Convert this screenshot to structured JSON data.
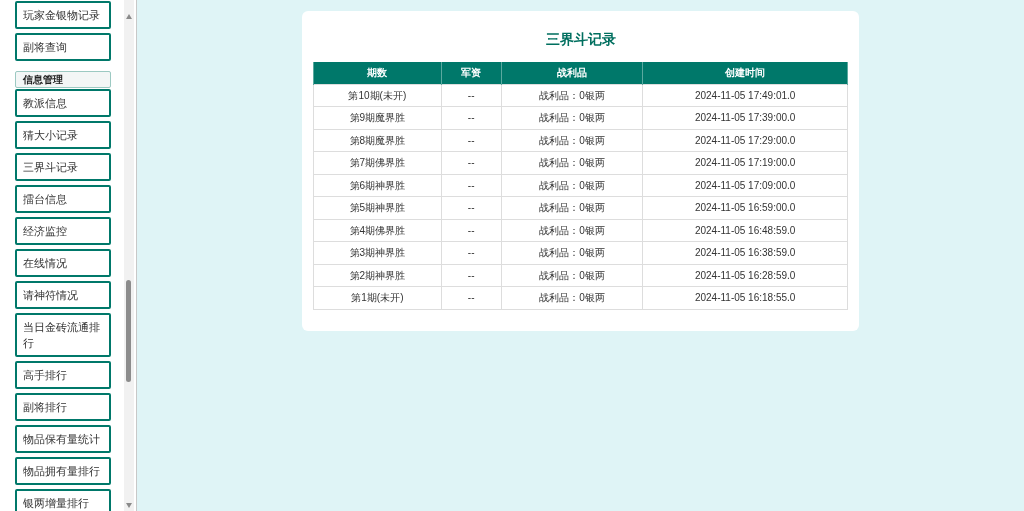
{
  "sidebar": {
    "items": [
      {
        "kind": "item",
        "label": "玩家金银物记录"
      },
      {
        "kind": "item",
        "label": "副将查询"
      },
      {
        "kind": "section",
        "label": "信息管理"
      },
      {
        "kind": "item",
        "label": "教派信息"
      },
      {
        "kind": "item",
        "label": "猜大小记录"
      },
      {
        "kind": "item",
        "label": "三界斗记录"
      },
      {
        "kind": "item",
        "label": "擂台信息"
      },
      {
        "kind": "item",
        "label": "经济监控"
      },
      {
        "kind": "item",
        "label": "在线情况"
      },
      {
        "kind": "item",
        "label": "请神符情况"
      },
      {
        "kind": "item",
        "label": "当日金砖流通排行"
      },
      {
        "kind": "item",
        "label": "高手排行"
      },
      {
        "kind": "item",
        "label": "副将排行"
      },
      {
        "kind": "item",
        "label": "物品保有量统计"
      },
      {
        "kind": "item",
        "label": "物品拥有量排行"
      },
      {
        "kind": "item",
        "label": "银两增量排行"
      }
    ]
  },
  "main": {
    "title": "三界斗记录",
    "table": {
      "columns": [
        "期数",
        "军资",
        "战利品",
        "创建时间"
      ],
      "rows": [
        [
          "第10期(未开)",
          "--",
          "战利品：0银两",
          "2024-11-05 17:49:01.0"
        ],
        [
          "第9期魔界胜",
          "--",
          "战利品：0银两",
          "2024-11-05 17:39:00.0"
        ],
        [
          "第8期魔界胜",
          "--",
          "战利品：0银两",
          "2024-11-05 17:29:00.0"
        ],
        [
          "第7期佛界胜",
          "--",
          "战利品：0银两",
          "2024-11-05 17:19:00.0"
        ],
        [
          "第6期神界胜",
          "--",
          "战利品：0银两",
          "2024-11-05 17:09:00.0"
        ],
        [
          "第5期神界胜",
          "--",
          "战利品：0银两",
          "2024-11-05 16:59:00.0"
        ],
        [
          "第4期佛界胜",
          "--",
          "战利品：0银两",
          "2024-11-05 16:48:59.0"
        ],
        [
          "第3期神界胜",
          "--",
          "战利品：0银两",
          "2024-11-05 16:38:59.0"
        ],
        [
          "第2期神界胜",
          "--",
          "战利品：0银两",
          "2024-11-05 16:28:59.0"
        ],
        [
          "第1期(未开)",
          "--",
          "战利品：0银两",
          "2024-11-05 16:18:55.0"
        ]
      ]
    }
  }
}
